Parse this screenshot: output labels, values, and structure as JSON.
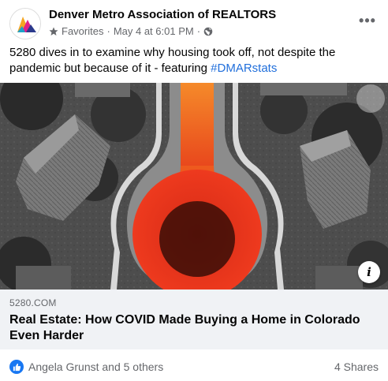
{
  "post": {
    "page_name": "Denver Metro Association of REALTORS",
    "audience_label": "Favorites",
    "timestamp": "May 4 at 6:01 PM",
    "separator": "·",
    "more_label": "•••",
    "message_text": "5280 dives in to examine why housing took off, not despite the pandemic but because of it - featuring ",
    "hashtag": "#DMARstats"
  },
  "link": {
    "domain": "5280.COM",
    "headline": "Real Estate: How COVID Made Buying a Home in Colorado Even Harder",
    "info_label": "i"
  },
  "engagement": {
    "reactors": "Angela Grunst and 5 others",
    "shares": "4 Shares"
  },
  "colors": {
    "hashtag": "#216fdb",
    "like_blue": "#1877f2",
    "caption_bg": "#f0f2f5",
    "secondary_text": "#65676b",
    "thermometer_red": "#e8351c",
    "thermometer_orange": "#f57a1f"
  },
  "icons": {
    "avatar": "dmar-logo-icon",
    "audience": "star-icon",
    "privacy": "globe-icon",
    "menu": "more-options-icon",
    "info": "info-icon",
    "reaction": "like-icon"
  }
}
